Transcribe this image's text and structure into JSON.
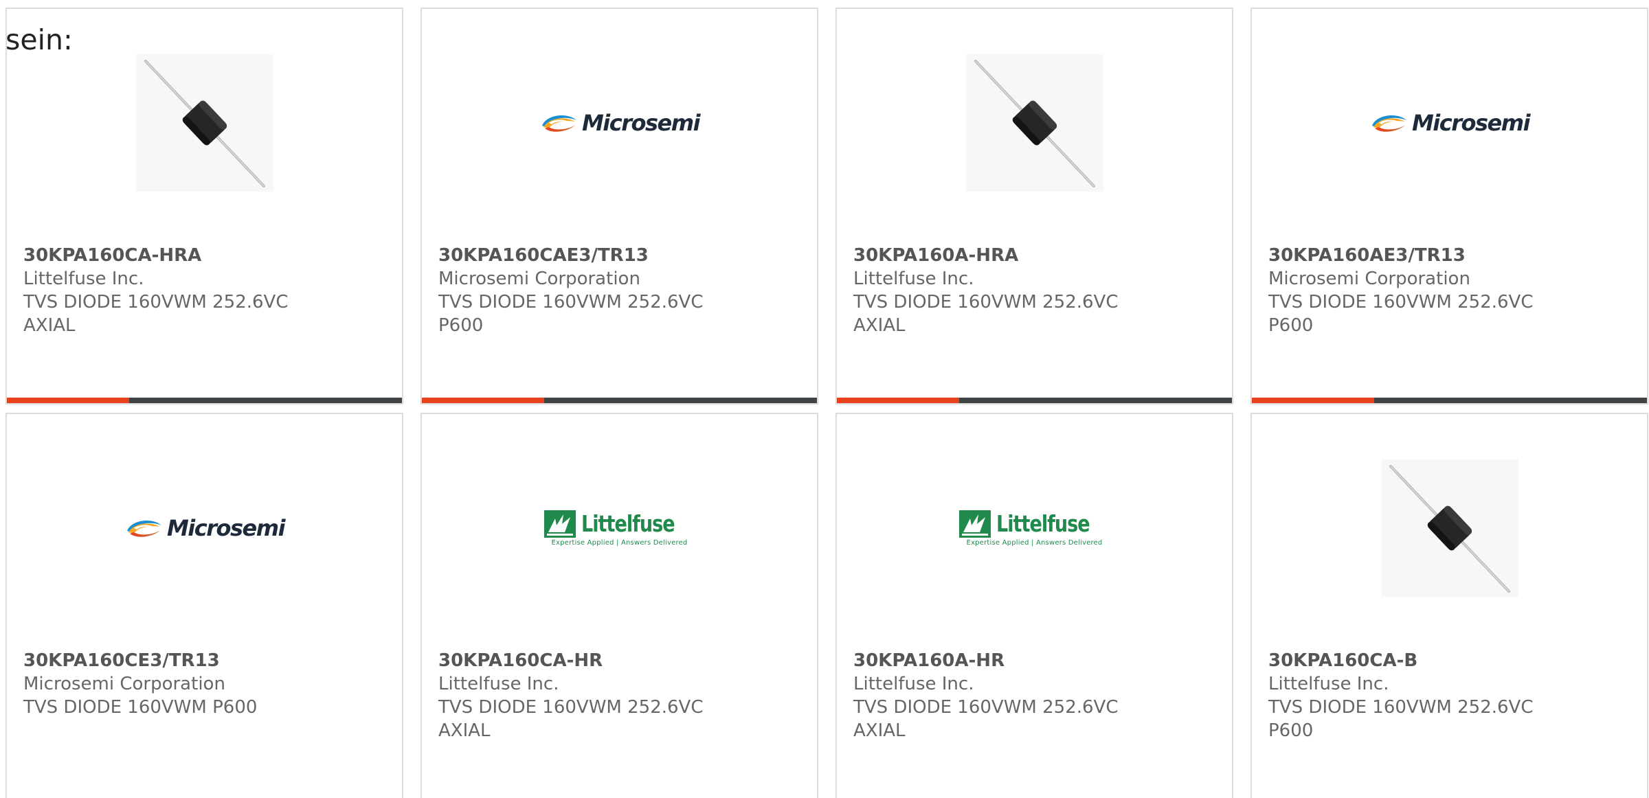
{
  "lead_text": "sein:",
  "colors": {
    "accent": "#e8411d",
    "bar_track": "#404346",
    "card_border": "#dcdcdc",
    "part_text": "#555555",
    "body_text": "#666666",
    "littelfuse_green": "#1f8a4c"
  },
  "products": [
    {
      "part": "30KPA160CA-HRA",
      "manufacturer": "Littelfuse Inc.",
      "desc1": "TVS DIODE 160VWM 252.6VC",
      "desc2": "AXIAL",
      "image": "axial-diode-photo",
      "progress": 0.31
    },
    {
      "part": "30KPA160CAE3/TR13",
      "manufacturer": "Microsemi Corporation",
      "desc1": "TVS DIODE 160VWM 252.6VC",
      "desc2": "P600",
      "image": "microsemi-logo",
      "progress": 0.31
    },
    {
      "part": "30KPA160A-HRA",
      "manufacturer": "Littelfuse Inc.",
      "desc1": "TVS DIODE 160VWM 252.6VC",
      "desc2": "AXIAL",
      "image": "axial-diode-photo",
      "progress": 0.31
    },
    {
      "part": "30KPA160AE3/TR13",
      "manufacturer": "Microsemi Corporation",
      "desc1": "TVS DIODE 160VWM 252.6VC",
      "desc2": "P600",
      "image": "microsemi-logo",
      "progress": 0.31
    },
    {
      "part": "30KPA160CE3/TR13",
      "manufacturer": "Microsemi Corporation",
      "desc1": "TVS DIODE 160VWM P600",
      "desc2": "",
      "image": "microsemi-logo"
    },
    {
      "part": "30KPA160CA-HR",
      "manufacturer": "Littelfuse Inc.",
      "desc1": "TVS DIODE 160VWM 252.6VC",
      "desc2": "AXIAL",
      "image": "littelfuse-logo"
    },
    {
      "part": "30KPA160A-HR",
      "manufacturer": "Littelfuse Inc.",
      "desc1": "TVS DIODE 160VWM 252.6VC",
      "desc2": "AXIAL",
      "image": "littelfuse-logo"
    },
    {
      "part": "30KPA160CA-B",
      "manufacturer": "Littelfuse Inc.",
      "desc1": "TVS DIODE 160VWM 252.6VC",
      "desc2": "P600",
      "image": "axial-diode-photo"
    }
  ],
  "logos": {
    "microsemi": "Microsemi",
    "littelfuse": "Littelfuse",
    "littelfuse_tagline": "Expertise Applied | Answers Delivered"
  }
}
